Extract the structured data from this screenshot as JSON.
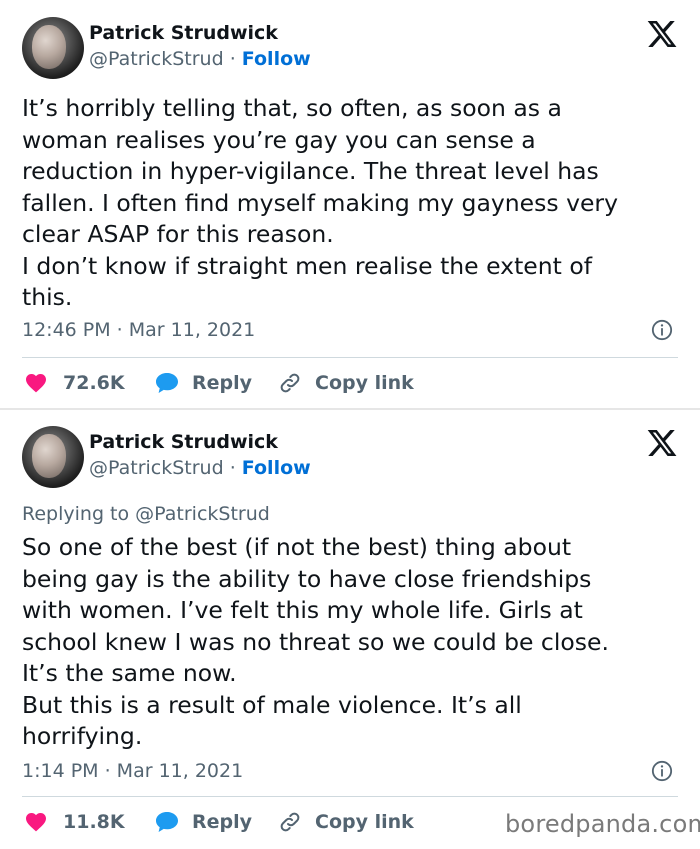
{
  "tweets": [
    {
      "author_name": "Patrick Strudwick",
      "handle": "@PatrickStrud",
      "separator": " · ",
      "follow_label": "Follow",
      "replying_to": "",
      "text": "It’s horribly telling that, so often, as soon as a\nwoman realises you’re gay you can sense a\nreduction in hyper-vigilance. The threat level has\nfallen. I often find myself making my gayness very\nclear ASAP for this reason.\nI don’t know if straight men realise the extent of\nthis.",
      "timestamp": "12:46 PM · Mar 11, 2021",
      "likes": "72.6K",
      "reply_label": "Reply",
      "copy_link_label": "Copy link",
      "icons": [
        "x-logo-icon",
        "info-icon",
        "heart-icon",
        "reply-bubble-icon",
        "link-icon"
      ]
    },
    {
      "author_name": "Patrick Strudwick",
      "handle": "@PatrickStrud",
      "separator": " · ",
      "follow_label": "Follow",
      "replying_to": "Replying to @PatrickStrud",
      "text": "So one of the best (if not the best) thing about\nbeing gay is the ability to have close friendships\nwith women. I’ve felt this my whole life. Girls at\nschool knew I was no threat so we could be close.\nIt’s the same now.\nBut this is a result of male violence. It’s all\nhorrifying.",
      "timestamp": "1:14 PM · Mar 11, 2021",
      "likes": "11.8K",
      "reply_label": "Reply",
      "copy_link_label": "Copy link",
      "icons": [
        "x-logo-icon",
        "info-icon",
        "heart-icon",
        "reply-bubble-icon",
        "link-icon"
      ]
    }
  ],
  "watermark": "boredpanda.com",
  "colors": {
    "heart": "#f91880",
    "reply": "#1d9bf0",
    "follow": "#006fd6",
    "secondary_text": "#536471"
  }
}
